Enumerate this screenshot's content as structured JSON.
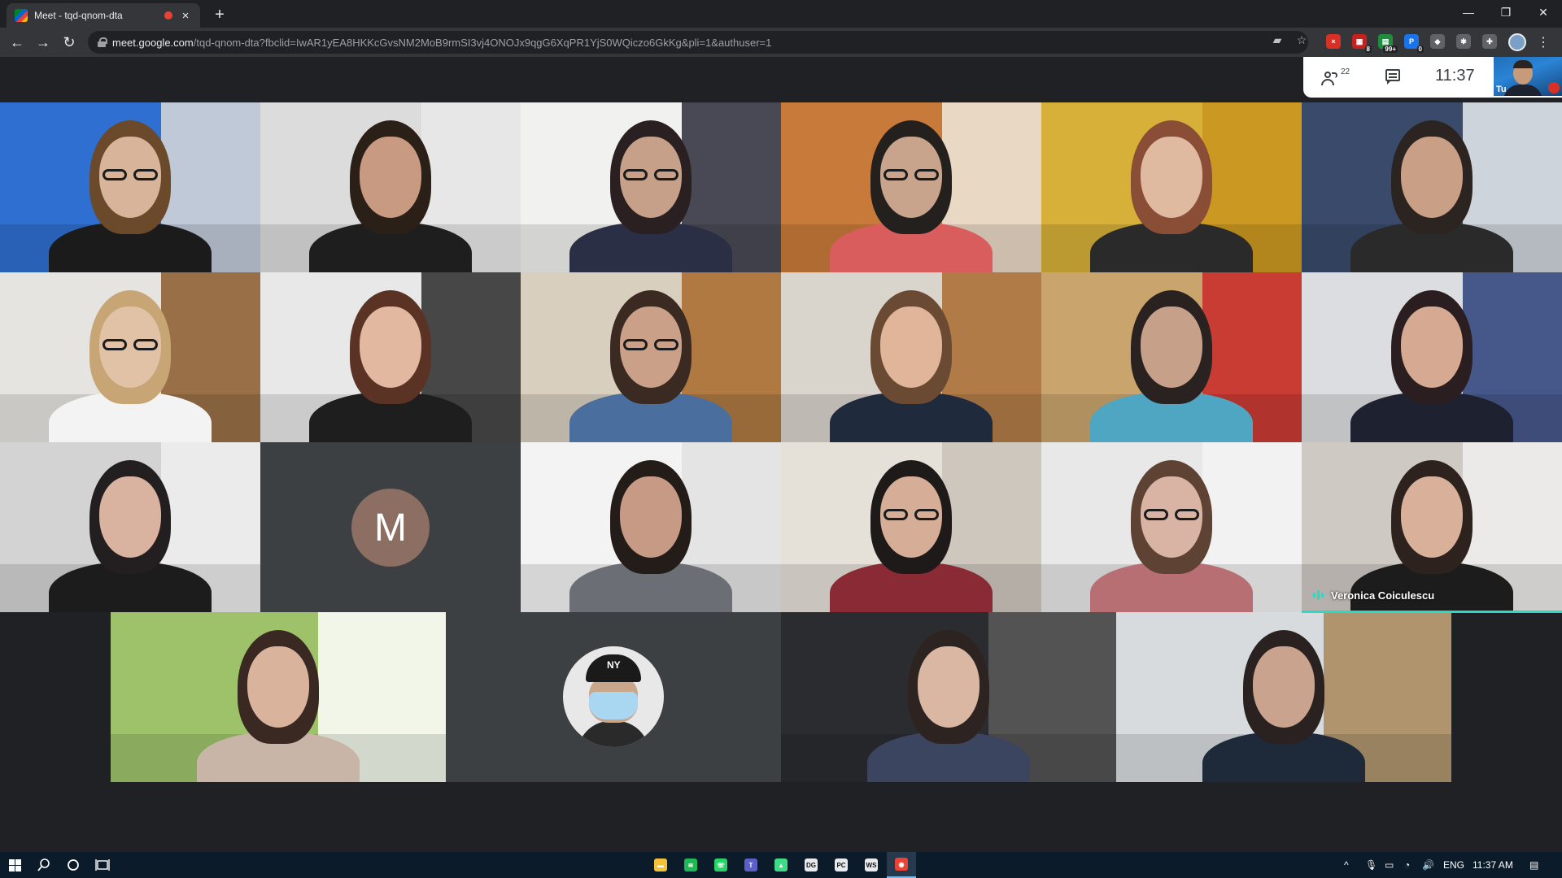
{
  "browser": {
    "tab_title": "Meet - tqd-qnom-dta",
    "tab_close": "×",
    "new_tab": "+",
    "window": {
      "minimize": "—",
      "restore": "❐",
      "close": "✕"
    },
    "nav": {
      "back": "←",
      "forward": "→",
      "reload": "↻"
    },
    "url_host": "meet.google.com",
    "url_path": "/tqd-qnom-dta?fbclid=IwAR1yEA8HKKcGvsNM2MoB9rmSI3vj4ONOJx9qgG6XqPR1YjS0WQiczo6GkKg&pli=1&authuser=1",
    "omnibox_icons": {
      "camera": "▰",
      "bookmark": "☆"
    },
    "extensions": [
      {
        "name": "ext-red-x",
        "color": "#d93025",
        "glyph": "×",
        "badge": ""
      },
      {
        "name": "ext-calendar",
        "color": "#c5221f",
        "glyph": "▦",
        "badge": "8"
      },
      {
        "name": "ext-green",
        "color": "#1e8e3e",
        "glyph": "▤",
        "badge": "99+"
      },
      {
        "name": "ext-blue",
        "color": "#1a73e8",
        "glyph": "P",
        "badge": "0"
      },
      {
        "name": "ext-shield",
        "color": "#5f6368",
        "glyph": "◆",
        "badge": ""
      },
      {
        "name": "ext-gear",
        "color": "#5f6368",
        "glyph": "✱",
        "badge": ""
      },
      {
        "name": "ext-puzzle",
        "color": "#5f6368",
        "glyph": "✚",
        "badge": ""
      }
    ],
    "menu": "⋮"
  },
  "meet": {
    "participants_count": "22",
    "clock": "11:37",
    "self_name": "Tu",
    "avatar_initial": "M",
    "cap_logo": "NY",
    "speaker_name": "Veronica Coiculescu",
    "speaking_color": "#2bd9c4"
  },
  "taskbar": {
    "apps": [
      {
        "name": "file-explorer",
        "color": "#f3c13a",
        "glyph": "▬"
      },
      {
        "name": "spotify",
        "color": "#1db954",
        "glyph": "≋"
      },
      {
        "name": "whatsapp",
        "color": "#25d366",
        "glyph": "☏"
      },
      {
        "name": "teams",
        "color": "#5b5fc7",
        "glyph": "T"
      },
      {
        "name": "android-studio",
        "color": "#3ddc84",
        "glyph": "▲"
      },
      {
        "name": "app-dg",
        "color": "#e8eaed",
        "glyph": "DG"
      },
      {
        "name": "pycharm",
        "color": "#e8eaed",
        "glyph": "PC"
      },
      {
        "name": "app-ws",
        "color": "#e8eaed",
        "glyph": "WS"
      },
      {
        "name": "chrome",
        "color": "#ea4335",
        "glyph": "◉"
      }
    ],
    "tray_chevron": "^",
    "tray_mic": "🎙",
    "tray_battery": "▭",
    "tray_wifi": "◔",
    "tray_volume": "🔊",
    "language": "ENG",
    "time": "11:37 AM",
    "notifications": "▤"
  }
}
